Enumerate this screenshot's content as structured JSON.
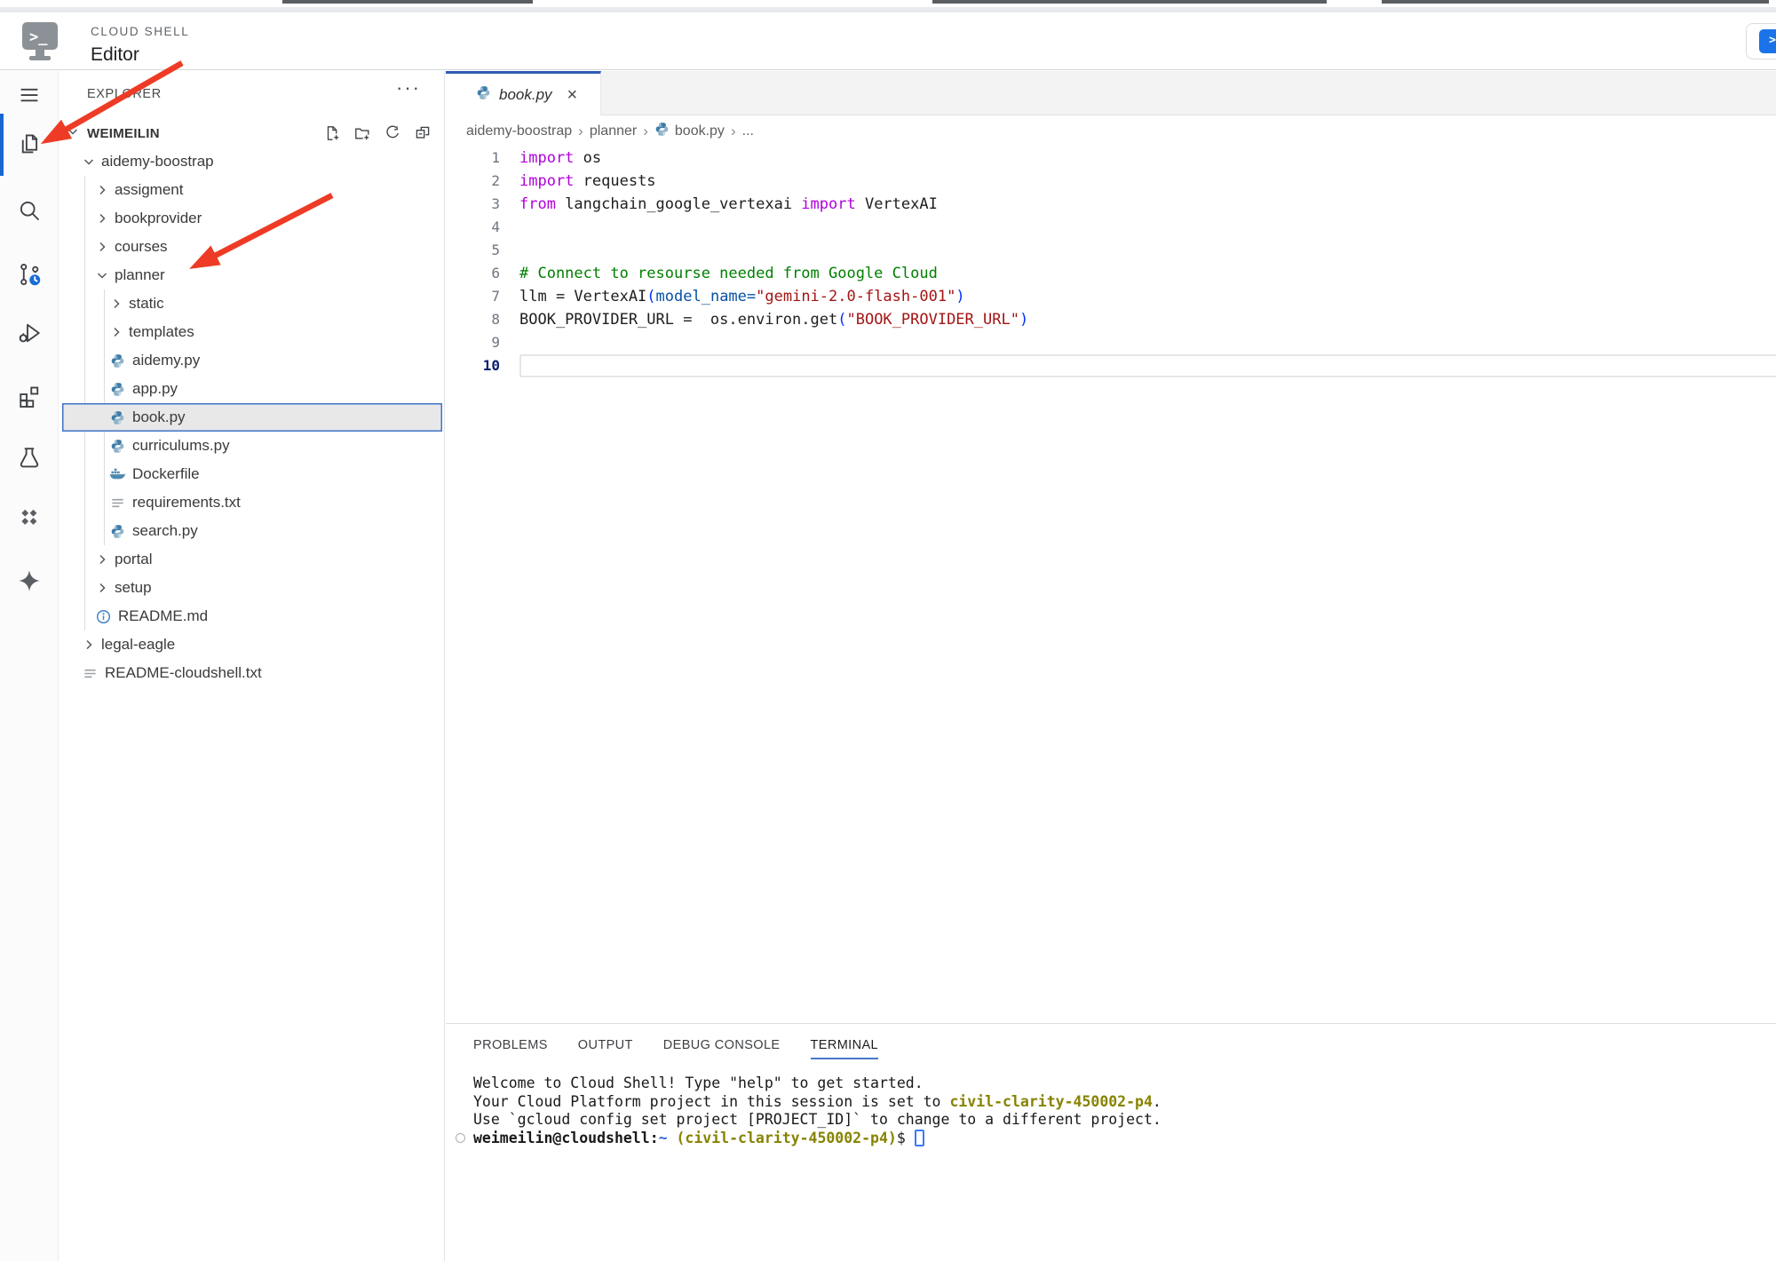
{
  "header": {
    "kicker": "CLOUD SHELL",
    "title": "Editor",
    "logo_glyph": ">_",
    "terminal_button_glyph": ">_"
  },
  "activity_bar": {
    "items": [
      {
        "id": "menu",
        "icon": "menu",
        "active": false
      },
      {
        "id": "explorer",
        "icon": "files",
        "active": true
      },
      {
        "id": "search",
        "icon": "search",
        "active": false
      },
      {
        "id": "source-control",
        "icon": "scm",
        "active": false,
        "badge": "clock"
      },
      {
        "id": "run-debug",
        "icon": "debug",
        "active": false
      },
      {
        "id": "extensions",
        "icon": "extensions",
        "active": false
      },
      {
        "id": "test-lab",
        "icon": "flask",
        "active": false
      },
      {
        "id": "cloud-code",
        "icon": "diamonds",
        "active": false
      },
      {
        "id": "gemini",
        "icon": "sparkle",
        "active": false
      }
    ]
  },
  "explorer": {
    "title": "EXPLORER",
    "more_label": "···",
    "workspace": "WEIMEILIN",
    "actions": [
      {
        "id": "new-file",
        "icon": "new-file"
      },
      {
        "id": "new-folder",
        "icon": "new-folder"
      },
      {
        "id": "refresh",
        "icon": "refresh"
      },
      {
        "id": "collapse-all",
        "icon": "collapse-all"
      }
    ],
    "tree": [
      {
        "label": "aidemy-boostrap",
        "depth": 1,
        "kind": "folder",
        "state": "expanded"
      },
      {
        "label": "assigment",
        "depth": 2,
        "kind": "folder",
        "state": "collapsed"
      },
      {
        "label": "bookprovider",
        "depth": 2,
        "kind": "folder",
        "state": "collapsed"
      },
      {
        "label": "courses",
        "depth": 2,
        "kind": "folder",
        "state": "collapsed"
      },
      {
        "label": "planner",
        "depth": 2,
        "kind": "folder",
        "state": "expanded"
      },
      {
        "label": "static",
        "depth": 3,
        "kind": "folder",
        "state": "collapsed"
      },
      {
        "label": "templates",
        "depth": 3,
        "kind": "folder",
        "state": "collapsed"
      },
      {
        "label": "aidemy.py",
        "depth": 3,
        "kind": "file",
        "icon": "python"
      },
      {
        "label": "app.py",
        "depth": 3,
        "kind": "file",
        "icon": "python"
      },
      {
        "label": "book.py",
        "depth": 3,
        "kind": "file",
        "icon": "python",
        "selected": true
      },
      {
        "label": "curriculums.py",
        "depth": 3,
        "kind": "file",
        "icon": "python"
      },
      {
        "label": "Dockerfile",
        "depth": 3,
        "kind": "file",
        "icon": "docker"
      },
      {
        "label": "requirements.txt",
        "depth": 3,
        "kind": "file",
        "icon": "text"
      },
      {
        "label": "search.py",
        "depth": 3,
        "kind": "file",
        "icon": "python"
      },
      {
        "label": "portal",
        "depth": 2,
        "kind": "folder",
        "state": "collapsed"
      },
      {
        "label": "setup",
        "depth": 2,
        "kind": "folder",
        "state": "collapsed"
      },
      {
        "label": "README.md",
        "depth": 2,
        "kind": "file",
        "icon": "info"
      },
      {
        "label": "legal-eagle",
        "depth": 1,
        "kind": "folder",
        "state": "collapsed"
      },
      {
        "label": "README-cloudshell.txt",
        "depth": 1,
        "kind": "file",
        "icon": "text"
      }
    ]
  },
  "editor": {
    "tab": {
      "label": "book.py",
      "icon": "python",
      "close_glyph": "×",
      "preview": true
    },
    "breadcrumb": {
      "separator": "›",
      "items": [
        {
          "label": "aidemy-boostrap"
        },
        {
          "label": "planner"
        },
        {
          "label": "book.py",
          "icon": "python"
        },
        {
          "label": "..."
        }
      ]
    },
    "code": {
      "lines": [
        {
          "n": 1,
          "tokens": [
            {
              "t": "import",
              "c": "kw"
            },
            {
              "t": " os",
              "c": "pl"
            }
          ]
        },
        {
          "n": 2,
          "tokens": [
            {
              "t": "import",
              "c": "kw"
            },
            {
              "t": " requests",
              "c": "pl"
            }
          ]
        },
        {
          "n": 3,
          "tokens": [
            {
              "t": "from",
              "c": "kw"
            },
            {
              "t": " langchain_google_vertexai ",
              "c": "pl"
            },
            {
              "t": "import",
              "c": "kw"
            },
            {
              "t": " VertexAI",
              "c": "pl"
            }
          ]
        },
        {
          "n": 4,
          "tokens": []
        },
        {
          "n": 5,
          "tokens": []
        },
        {
          "n": 6,
          "tokens": [
            {
              "t": "# Connect to resourse needed from Google Cloud",
              "c": "cm"
            }
          ]
        },
        {
          "n": 7,
          "tokens": [
            {
              "t": "llm = VertexAI",
              "c": "pl"
            },
            {
              "t": "(",
              "c": "br"
            },
            {
              "t": "model_name=",
              "c": "pm"
            },
            {
              "t": "\"gemini-2.0-flash-001\"",
              "c": "st"
            },
            {
              "t": ")",
              "c": "br"
            }
          ]
        },
        {
          "n": 8,
          "tokens": [
            {
              "t": "BOOK_PROVIDER_URL =  os.environ.get",
              "c": "pl"
            },
            {
              "t": "(",
              "c": "br"
            },
            {
              "t": "\"BOOK_PROVIDER_URL\"",
              "c": "st"
            },
            {
              "t": ")",
              "c": "br"
            }
          ]
        },
        {
          "n": 9,
          "tokens": []
        },
        {
          "n": 10,
          "tokens": [],
          "current": true
        }
      ]
    }
  },
  "panel": {
    "tabs": [
      {
        "label": "PROBLEMS",
        "active": false
      },
      {
        "label": "OUTPUT",
        "active": false
      },
      {
        "label": "DEBUG CONSOLE",
        "active": false
      },
      {
        "label": "TERMINAL",
        "active": true
      }
    ],
    "terminal": {
      "lines": [
        {
          "tokens": [
            {
              "t": "Welcome to Cloud Shell! Type \"help\" to get started.",
              "c": "pl"
            }
          ]
        },
        {
          "tokens": [
            {
              "t": "Your Cloud Platform project in this session is set to ",
              "c": "pl"
            },
            {
              "t": "civil-clarity-450002-p4",
              "c": "ob"
            },
            {
              "t": ".",
              "c": "pl"
            }
          ]
        },
        {
          "tokens": [
            {
              "t": "Use `gcloud config set project [PROJECT_ID]` to change to a different project.",
              "c": "pl"
            }
          ]
        },
        {
          "prompt": true,
          "cursor": true,
          "tokens": [
            {
              "t": "weimeilin@cloudshell",
              "c": "bd"
            },
            {
              "t": ":",
              "c": "bd"
            },
            {
              "t": "~",
              "c": "bl"
            },
            {
              "t": " ",
              "c": "pl"
            },
            {
              "t": "(civil-clarity-450002-p4)",
              "c": "ob"
            },
            {
              "t": "$ ",
              "c": "pl"
            }
          ]
        }
      ]
    }
  },
  "colors": {
    "accent_blue": "#2f5bb7",
    "selection_border": "#4073c5",
    "arrow_red": "#ee3b25",
    "terminal_olive": "#878300",
    "terminal_blue": "#2f62d8",
    "badge_blue": "#1a6dd2"
  }
}
